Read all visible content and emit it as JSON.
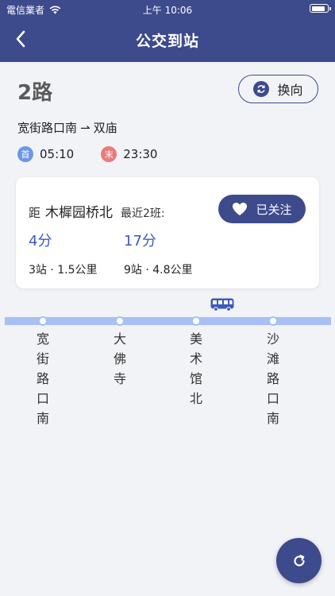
{
  "status_bar": {
    "carrier": "電信業者",
    "time": "上午 10:06",
    "battery_level": 0.92
  },
  "header": {
    "title": "公交到站",
    "back_icon": "chevron-left-icon"
  },
  "route": {
    "name": "2路",
    "swap_label": "换向",
    "swap_icon": "refresh-icon",
    "from": "宽街路口南",
    "arrow": "⇀",
    "to": "双庙",
    "first_badge": "首",
    "first_time": "05:10",
    "last_badge": "末",
    "last_time": "23:30"
  },
  "arrival": {
    "prefix": "距",
    "station": "木樨园桥北",
    "recent_label": "最近2班:",
    "follow_label": "已关注",
    "follow_icon": "heart-icon",
    "buses": [
      {
        "eta": "4分",
        "distance": "3站 · 1.5公里"
      },
      {
        "eta": "17分",
        "distance": "9站 · 4.8公里"
      }
    ]
  },
  "stops": [
    "宽街路口南",
    "大佛寺",
    "美术馆北",
    "沙滩路口南"
  ],
  "bus_icon": "bus-icon",
  "refresh_icon": "refresh-icon",
  "colors": {
    "primary": "#3d4a8c",
    "track": "#a7c0f5",
    "eta": "#3d5ab8",
    "first_badge": "#6a97e8",
    "last_badge": "#ea7b7b"
  }
}
